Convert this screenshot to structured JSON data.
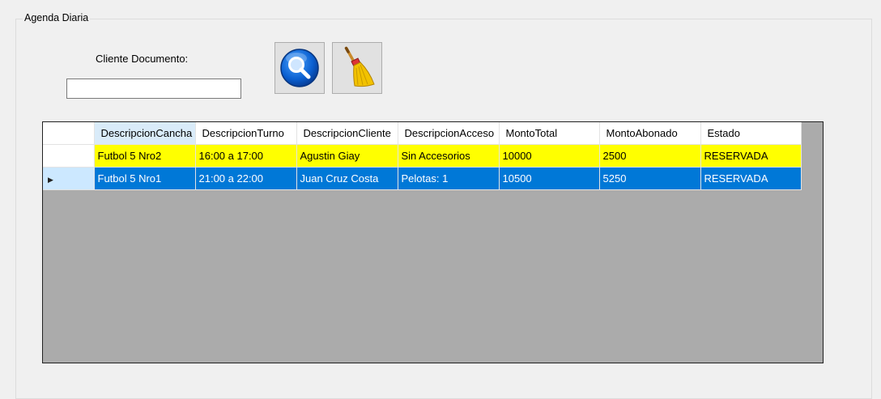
{
  "group": {
    "title": "Agenda Diaria"
  },
  "search": {
    "label": "Cliente Documento:",
    "value": "",
    "search_icon": "magnifier-icon",
    "clear_icon": "broom-icon"
  },
  "grid": {
    "columns": [
      "DescripcionCancha",
      "DescripcionTurno",
      "DescripcionCliente",
      "DescripcionAcceso",
      "MontoTotal",
      "MontoAbonado",
      "Estado"
    ],
    "rows": [
      {
        "cells": [
          "Futbol 5 Nro2",
          "16:00 a 17:00",
          "Agustin Giay",
          "Sin Accesorios",
          "10000",
          "2500",
          "RESERVADA"
        ],
        "highlight": "#ffff00"
      },
      {
        "cells": [
          "Futbol 5 Nro1",
          "21:00 a 22:00",
          "Juan Cruz Costa",
          "Pelotas: 1",
          "10500",
          "5250",
          "RESERVADA"
        ],
        "highlight": "#0078d7"
      }
    ],
    "current_row_indicator": "row-arrow-icon"
  },
  "colors": {
    "selection": "#0078d7",
    "highlight": "#ffff00",
    "grid_background": "#ababab"
  }
}
